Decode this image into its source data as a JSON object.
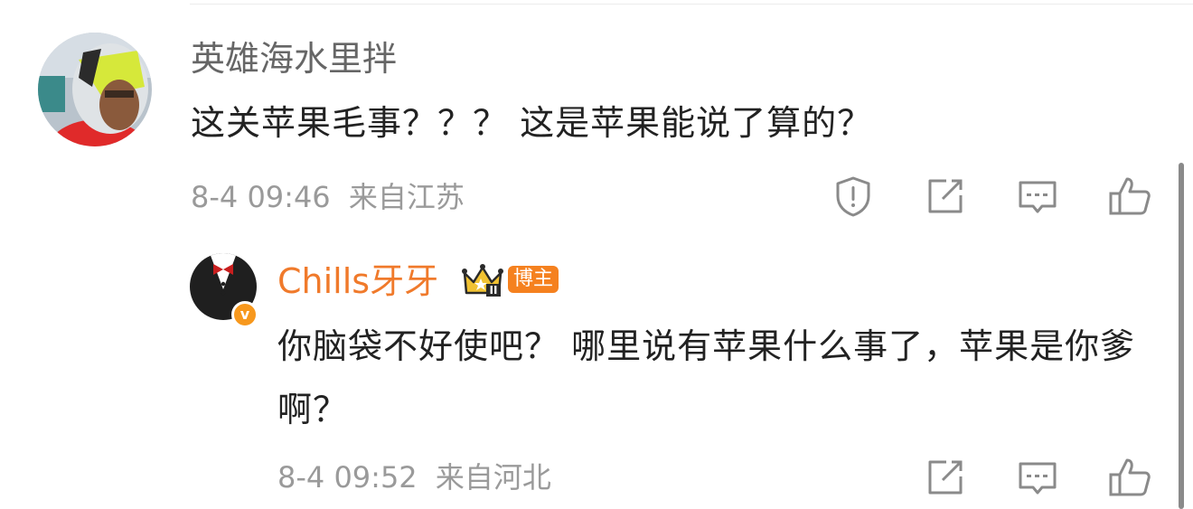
{
  "theme": {
    "username_gray": "#666666",
    "blogger_orange": "#f07a2b",
    "badge_orange": "#f5811f",
    "verified_orange": "#f7981d",
    "icon_gray": "#8a8a8a"
  },
  "comment": {
    "username": "英雄海水里拌",
    "text": "这关苹果毛事？？？ 这是苹果能说了算的？",
    "timestamp": "8-4 09:46",
    "location": "来自江苏",
    "actions": [
      "report-icon",
      "forward-icon",
      "comment-icon",
      "like-icon"
    ]
  },
  "reply": {
    "username": "Chills牙牙",
    "role_badge": "博主",
    "crown_level": "II",
    "verified_mark": "v",
    "text": "你脑袋不好使吧？ 哪里说有苹果什么事了，苹果是你爹啊？",
    "timestamp": "8-4 09:52",
    "location": "来自河北",
    "actions": [
      "forward-icon",
      "comment-icon",
      "like-icon"
    ]
  }
}
